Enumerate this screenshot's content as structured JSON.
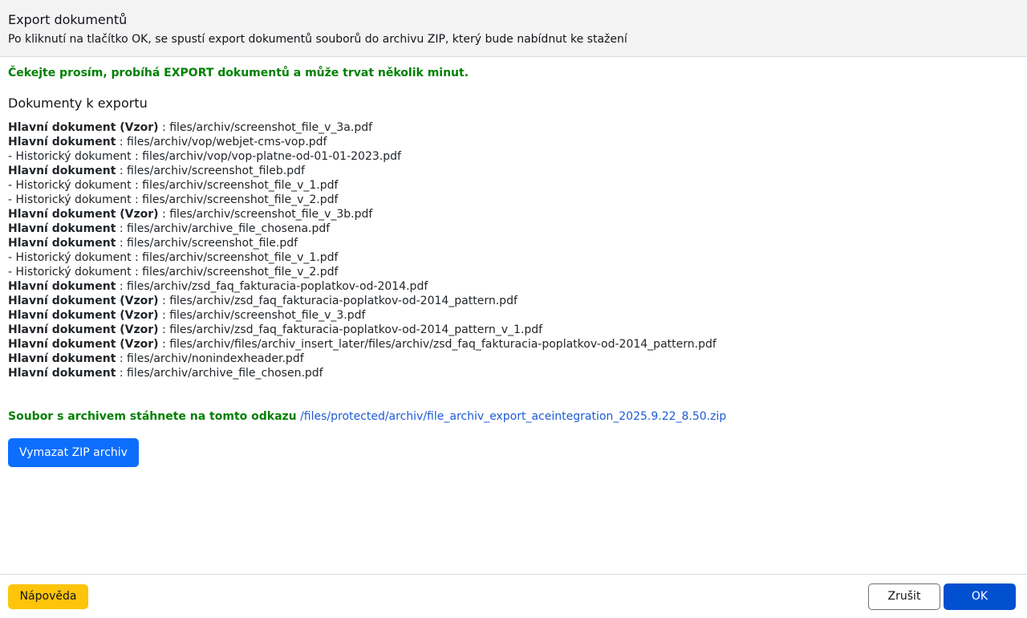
{
  "header": {
    "title": "Export dokumentů",
    "description": "Po kliknutí na tlačítko OK, se spustí export dokumentů souborů do archivu ZIP, který bude nabídnut ke stažení"
  },
  "body": {
    "wait_message": "Čekejte prosím, probíhá EXPORT dokumentů a může trvat několik minut.",
    "section_title": "Dokumenty k exportu",
    "documents": [
      {
        "bold": "Hlavní dokument (Vzor)",
        "rest": " : files/archiv/screenshot_file_v_3a.pdf"
      },
      {
        "bold": "Hlavní dokument",
        "rest": " : files/archiv/vop/webjet-cms-vop.pdf"
      },
      {
        "bold": "",
        "rest": "- Historický dokument : files/archiv/vop/vop-platne-od-01-01-2023.pdf"
      },
      {
        "bold": "Hlavní dokument",
        "rest": " : files/archiv/screenshot_fileb.pdf"
      },
      {
        "bold": "",
        "rest": "- Historický dokument : files/archiv/screenshot_file_v_1.pdf"
      },
      {
        "bold": "",
        "rest": "- Historický dokument : files/archiv/screenshot_file_v_2.pdf"
      },
      {
        "bold": "Hlavní dokument (Vzor)",
        "rest": " : files/archiv/screenshot_file_v_3b.pdf"
      },
      {
        "bold": "Hlavní dokument",
        "rest": " : files/archiv/archive_file_chosena.pdf"
      },
      {
        "bold": "Hlavní dokument",
        "rest": " : files/archiv/screenshot_file.pdf"
      },
      {
        "bold": "",
        "rest": "- Historický dokument : files/archiv/screenshot_file_v_1.pdf"
      },
      {
        "bold": "",
        "rest": "- Historický dokument : files/archiv/screenshot_file_v_2.pdf"
      },
      {
        "bold": "Hlavní dokument",
        "rest": " : files/archiv/zsd_faq_fakturacia-poplatkov-od-2014.pdf"
      },
      {
        "bold": "Hlavní dokument (Vzor)",
        "rest": " : files/archiv/zsd_faq_fakturacia-poplatkov-od-2014_pattern.pdf"
      },
      {
        "bold": "Hlavní dokument (Vzor)",
        "rest": " : files/archiv/screenshot_file_v_3.pdf"
      },
      {
        "bold": "Hlavní dokument (Vzor)",
        "rest": " : files/archiv/zsd_faq_fakturacia-poplatkov-od-2014_pattern_v_1.pdf"
      },
      {
        "bold": "Hlavní dokument (Vzor)",
        "rest": " : files/archiv/files/archiv_insert_later/files/archiv/zsd_faq_fakturacia-poplatkov-od-2014_pattern.pdf"
      },
      {
        "bold": "Hlavní dokument",
        "rest": " : files/archiv/nonindexheader.pdf"
      },
      {
        "bold": "Hlavní dokument",
        "rest": " : files/archiv/archive_file_chosen.pdf"
      }
    ],
    "download_label": "Soubor s archivem stáhnete na tomto odkazu",
    "download_link": "/files/protected/archiv/file_archiv_export_aceintegration_2025.9.22_8.50.zip",
    "delete_zip_label": "Vymazat ZIP archiv"
  },
  "footer": {
    "help_label": "Nápověda",
    "cancel_label": "Zrušit",
    "ok_label": "OK"
  },
  "colors": {
    "success_green": "#008000",
    "link_blue": "#1d5bd6",
    "primary_blue": "#0d6efd",
    "ok_blue": "#0050d0",
    "help_yellow": "#fdc40a"
  }
}
